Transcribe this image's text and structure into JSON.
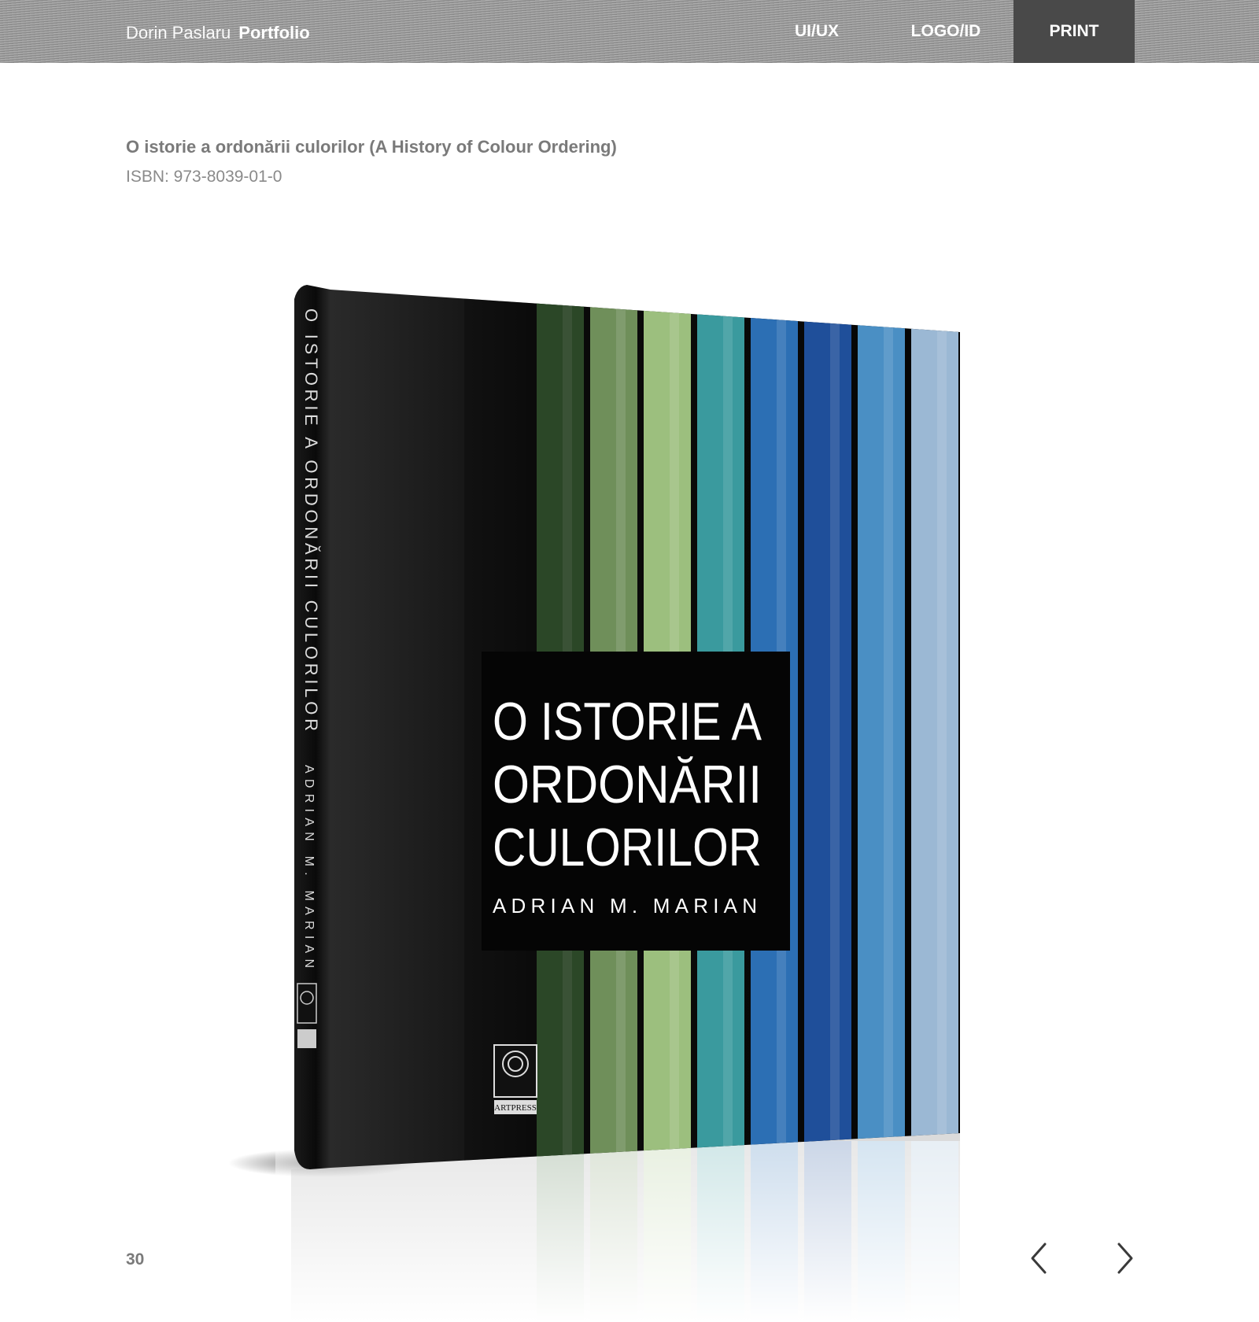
{
  "header": {
    "brand_name": "Dorin Paslaru",
    "brand_section": "Portfolio",
    "nav": [
      {
        "label": "UI/UX",
        "active": false
      },
      {
        "label": "LOGO/ID",
        "active": false
      },
      {
        "label": "PRINT",
        "active": true
      }
    ]
  },
  "project": {
    "title": "O istorie a ordonării culorilor (A History of Colour Ordering)",
    "isbn": "ISBN: 973-8039-01-0"
  },
  "book": {
    "spine_title": "O ISTORIE A ORDONĂRII CULORILOR",
    "spine_author": "ADRIAN M. MARIAN",
    "cover_title_lines": [
      "O ISTORIE A",
      "ORDONĂRII",
      "CULORILOR"
    ],
    "cover_author": "ADRIAN M. MARIAN",
    "publisher_logo": "ARTPRESS",
    "stripe_colors": [
      "#3f6a3a",
      "#6f8f5a",
      "#9cbf7e",
      "#3a9a9e",
      "#2c6fb4",
      "#1f4f9a",
      "#4a8fc4",
      "#9bb8d4"
    ]
  },
  "footer": {
    "page_number": "30",
    "prev_icon": "chevron-left-icon",
    "next_icon": "chevron-right-icon"
  }
}
